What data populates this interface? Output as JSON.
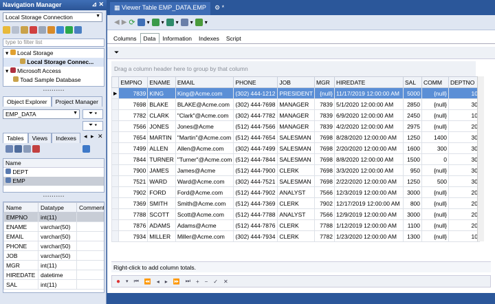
{
  "nav": {
    "title": "Navigation Manager",
    "connection": "Local Storage Connection",
    "filter_placeholder": "type to filter list",
    "tree": [
      {
        "label": "Local Storage",
        "level": 0
      },
      {
        "label": "Local Storage Connec...",
        "level": 1
      },
      {
        "label": "Microsoft Access",
        "level": 0
      },
      {
        "label": "Toad Sample Database",
        "level": 1
      }
    ]
  },
  "explorer": {
    "tabs": [
      "Object Explorer",
      "Project Manager"
    ],
    "schema": "EMP_DATA",
    "obj_tabs": [
      "Tables",
      "Views",
      "Indexes"
    ],
    "name_header": "Name",
    "tables": [
      "DEPT",
      "EMP"
    ],
    "col_headers": [
      "Name",
      "Datatype",
      "Comment"
    ],
    "columns": [
      [
        "EMPNO",
        "int(11)"
      ],
      [
        "ENAME",
        "varchar(50)"
      ],
      [
        "EMAIL",
        "varchar(50)"
      ],
      [
        "PHONE",
        "varchar(50)"
      ],
      [
        "JOB",
        "varchar(50)"
      ],
      [
        "MGR",
        "int(11)"
      ],
      [
        "HIREDATE",
        "datetime"
      ],
      [
        "SAL",
        "int(11)"
      ]
    ]
  },
  "doc_tabs": [
    "Viewer Table EMP_DATA.EMP",
    "*"
  ],
  "sub_tabs": [
    "Columns",
    "Data",
    "Information",
    "Indexes",
    "Script"
  ],
  "group_hint": "Drag a column header here to group by that column",
  "grid": {
    "headers": [
      "EMPNO",
      "ENAME",
      "EMAIL",
      "PHONE",
      "JOB",
      "MGR",
      "HIREDATE",
      "SAL",
      "COMM",
      "DEPTNO"
    ],
    "rows": [
      [
        "7839",
        "KING",
        "King@Acme.com",
        "(302) 444-1212",
        "PRESIDENT",
        "{null}",
        "11/17/2019 12:00:00 AM",
        "5000",
        "{null}",
        "10"
      ],
      [
        "7698",
        "BLAKE",
        "BLAKE@Acme.com",
        "(302) 444-7698",
        "MANAGER",
        "7839",
        "5/1/2020 12:00:00 AM",
        "2850",
        "{null}",
        "30"
      ],
      [
        "7782",
        "CLARK",
        "\"Clark\"@Acme.com",
        "(302) 444-7782",
        "MANAGER",
        "7839",
        "6/9/2020 12:00:00 AM",
        "2450",
        "{null}",
        "10"
      ],
      [
        "7566",
        "JONES",
        "Jones@Acme",
        "(512) 444-7566",
        "MANAGER",
        "7839",
        "4/2/2020 12:00:00 AM",
        "2975",
        "{null}",
        "20"
      ],
      [
        "7654",
        "MARTIN",
        "\"Martin\"@Acme.com",
        "(512) 444-7654",
        "SALESMAN",
        "7698",
        "8/28/2020 12:00:00 AM",
        "1250",
        "1400",
        "30"
      ],
      [
        "7499",
        "ALLEN",
        "Allen@Acme.com",
        "(302) 444-7499",
        "SALESMAN",
        "7698",
        "2/20/2020 12:00:00 AM",
        "1600",
        "300",
        "30"
      ],
      [
        "7844",
        "TURNER",
        "\"Turner\"@Acme.com",
        "(512) 444-7844",
        "SALESMAN",
        "7698",
        "8/8/2020 12:00:00 AM",
        "1500",
        "0",
        "30"
      ],
      [
        "7900",
        "JAMES",
        "James@Acme",
        "(512) 444-7900",
        "CLERK",
        "7698",
        "3/3/2020 12:00:00 AM",
        "950",
        "{null}",
        "30"
      ],
      [
        "7521",
        "WARD",
        "Ward@Acme.com",
        "(302) 444-7521",
        "SALESMAN",
        "7698",
        "2/22/2020 12:00:00 AM",
        "1250",
        "500",
        "30"
      ],
      [
        "7902",
        "FORD",
        "Ford@Acme.com",
        "(512) 444-7902",
        "ANALYST",
        "7566",
        "12/3/2019 12:00:00 AM",
        "3000",
        "{null}",
        "20"
      ],
      [
        "7369",
        "SMITH",
        "Smith@Acme.com",
        "(512) 444-7369",
        "CLERK",
        "7902",
        "12/17/2019 12:00:00 AM",
        "800",
        "{null}",
        "20"
      ],
      [
        "7788",
        "SCOTT",
        "Scott@Acme.com",
        "(512) 444-7788",
        "ANALYST",
        "7566",
        "12/9/2019 12:00:00 AM",
        "3000",
        "{null}",
        "20"
      ],
      [
        "7876",
        "ADAMS",
        "Adams@Acme",
        "(512) 444-7876",
        "CLERK",
        "7788",
        "1/12/2019 12:00:00 AM",
        "1100",
        "{null}",
        "20"
      ],
      [
        "7934",
        "MILLER",
        "Miller@Acme.com",
        "(302) 444-7934",
        "CLERK",
        "7782",
        "1/23/2020 12:00:00 AM",
        "1300",
        "{null}",
        "10"
      ]
    ]
  },
  "status_text": "Right-click to add column totals.",
  "nav_buttons": [
    "first",
    "prev-page",
    "prev",
    "next",
    "next-page",
    "last",
    "add",
    "delete",
    "post",
    "cancel"
  ],
  "colors": {
    "accent": "#2b579a",
    "selected_row": "#5b8fd6"
  }
}
